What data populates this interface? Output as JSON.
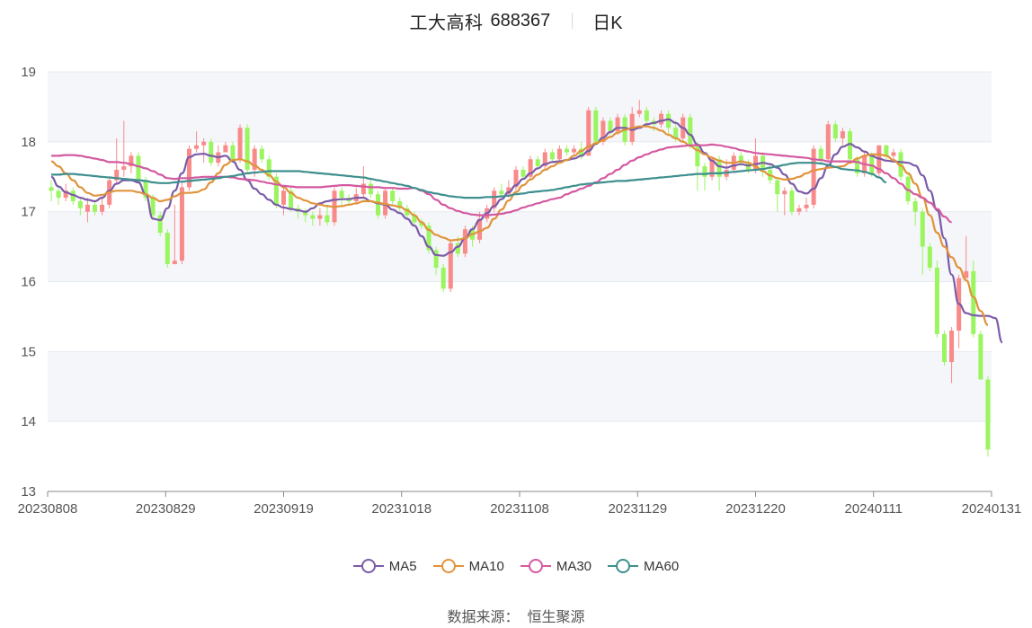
{
  "header": {
    "name": "工大高科",
    "code": "688367",
    "period": "日K"
  },
  "source": {
    "label": "数据来源：",
    "value": "恒生聚源"
  },
  "colors": {
    "up": "#f88a8a",
    "down": "#9af55f",
    "ma5": "#7b5ba8",
    "ma10": "#e0943c",
    "ma30": "#d35aa0",
    "ma60": "#3f8f8f",
    "grid": "#e6e9f0",
    "band": "#f5f6fa"
  },
  "chart_data": {
    "type": "candlestick",
    "ylim": [
      13,
      19
    ],
    "yticks": [
      "13",
      "14",
      "15",
      "16",
      "17",
      "18",
      "19"
    ],
    "x_tick_labels": [
      "20230808",
      "20230829",
      "20230919",
      "20231018",
      "20231108",
      "20231129",
      "20231220",
      "20240111",
      "20240131"
    ],
    "legend": [
      "MA5",
      "MA10",
      "MA30",
      "MA60"
    ],
    "candles": [
      [
        17.35,
        17.3,
        17.45,
        17.15
      ],
      [
        17.3,
        17.2,
        17.35,
        17.1
      ],
      [
        17.2,
        17.3,
        17.4,
        17.15
      ],
      [
        17.3,
        17.15,
        17.35,
        17.1
      ],
      [
        17.15,
        17.05,
        17.2,
        16.95
      ],
      [
        17.0,
        17.1,
        17.2,
        16.85
      ],
      [
        17.1,
        17.0,
        17.15,
        16.95
      ],
      [
        17.0,
        17.1,
        17.2,
        16.95
      ],
      [
        17.1,
        17.45,
        17.5,
        17.05
      ],
      [
        17.45,
        17.6,
        18.05,
        17.4
      ],
      [
        17.6,
        17.65,
        18.3,
        17.5
      ],
      [
        17.65,
        17.8,
        17.85,
        17.55
      ],
      [
        17.8,
        17.45,
        17.85,
        17.4
      ],
      [
        17.45,
        17.2,
        17.5,
        17.15
      ],
      [
        17.2,
        16.95,
        17.25,
        16.9
      ],
      [
        16.95,
        16.7,
        17.0,
        16.65
      ],
      [
        16.7,
        16.25,
        16.75,
        16.2
      ],
      [
        16.25,
        16.3,
        17.1,
        16.25
      ],
      [
        16.3,
        17.35,
        17.45,
        16.25
      ],
      [
        17.35,
        17.9,
        17.95,
        17.3
      ],
      [
        17.9,
        17.95,
        18.15,
        17.85
      ],
      [
        17.95,
        18.0,
        18.05,
        17.7
      ],
      [
        18.0,
        17.7,
        18.05,
        17.65
      ],
      [
        17.7,
        17.85,
        17.95,
        17.65
      ],
      [
        17.85,
        17.95,
        18.0,
        17.85
      ],
      [
        17.95,
        17.75,
        18.0,
        17.7
      ],
      [
        17.75,
        18.2,
        18.25,
        17.7
      ],
      [
        18.2,
        17.6,
        18.25,
        17.55
      ],
      [
        17.6,
        17.9,
        17.95,
        17.5
      ],
      [
        17.9,
        17.75,
        17.95,
        17.7
      ],
      [
        17.75,
        17.5,
        17.8,
        17.45
      ],
      [
        17.5,
        17.1,
        17.55,
        17.05
      ],
      [
        17.1,
        17.3,
        17.35,
        16.95
      ],
      [
        17.3,
        17.05,
        17.35,
        17.0
      ],
      [
        17.05,
        17.0,
        17.1,
        16.9
      ],
      [
        17.0,
        16.95,
        17.05,
        16.85
      ],
      [
        16.95,
        16.9,
        17.0,
        16.8
      ],
      [
        16.9,
        16.95,
        17.05,
        16.8
      ],
      [
        16.95,
        16.85,
        17.1,
        16.8
      ],
      [
        16.85,
        17.3,
        17.35,
        16.8
      ],
      [
        17.3,
        17.2,
        17.35,
        17.1
      ],
      [
        17.2,
        17.15,
        17.25,
        17.1
      ],
      [
        17.15,
        17.25,
        17.35,
        17.1
      ],
      [
        17.25,
        17.4,
        17.65,
        17.2
      ],
      [
        17.4,
        17.25,
        17.45,
        17.2
      ],
      [
        17.25,
        16.95,
        17.3,
        16.9
      ],
      [
        16.95,
        17.3,
        17.35,
        16.9
      ],
      [
        17.3,
        17.15,
        17.35,
        17.1
      ],
      [
        17.15,
        17.05,
        17.2,
        17.0
      ],
      [
        17.05,
        16.95,
        17.1,
        16.9
      ],
      [
        16.95,
        16.85,
        17.0,
        16.8
      ],
      [
        16.85,
        16.8,
        16.9,
        16.75
      ],
      [
        16.8,
        16.45,
        16.85,
        16.4
      ],
      [
        16.45,
        16.2,
        16.5,
        16.1
      ],
      [
        16.2,
        15.9,
        16.25,
        15.85
      ],
      [
        15.9,
        16.55,
        16.6,
        15.85
      ],
      [
        16.55,
        16.4,
        16.65,
        16.35
      ],
      [
        16.4,
        16.75,
        16.8,
        16.35
      ],
      [
        16.75,
        16.6,
        16.8,
        16.5
      ],
      [
        16.6,
        16.9,
        17.0,
        16.55
      ],
      [
        16.9,
        17.05,
        17.1,
        16.85
      ],
      [
        17.05,
        17.3,
        17.35,
        17.0
      ],
      [
        17.3,
        17.25,
        17.4,
        17.2
      ],
      [
        17.25,
        17.35,
        17.45,
        17.2
      ],
      [
        17.35,
        17.6,
        17.65,
        17.3
      ],
      [
        17.6,
        17.5,
        17.65,
        17.45
      ],
      [
        17.5,
        17.75,
        17.8,
        17.45
      ],
      [
        17.75,
        17.65,
        17.8,
        17.6
      ],
      [
        17.65,
        17.85,
        17.9,
        17.6
      ],
      [
        17.85,
        17.75,
        17.9,
        17.7
      ],
      [
        17.75,
        17.9,
        17.95,
        17.7
      ],
      [
        17.9,
        17.85,
        17.95,
        17.8
      ],
      [
        17.85,
        17.9,
        17.95,
        17.8
      ],
      [
        17.9,
        17.8,
        18.0,
        17.75
      ],
      [
        17.8,
        18.45,
        18.5,
        17.8
      ],
      [
        18.45,
        18.0,
        18.5,
        17.95
      ],
      [
        18.0,
        18.3,
        18.35,
        17.95
      ],
      [
        18.3,
        18.15,
        18.35,
        18.1
      ],
      [
        18.15,
        18.35,
        18.4,
        18.1
      ],
      [
        18.35,
        18.0,
        18.4,
        17.95
      ],
      [
        18.0,
        18.4,
        18.5,
        17.95
      ],
      [
        18.4,
        18.45,
        18.6,
        18.35
      ],
      [
        18.45,
        18.3,
        18.5,
        18.25
      ],
      [
        18.3,
        18.25,
        18.35,
        18.15
      ],
      [
        18.25,
        18.4,
        18.45,
        18.2
      ],
      [
        18.4,
        18.2,
        18.45,
        18.1
      ],
      [
        18.2,
        18.05,
        18.3,
        18.0
      ],
      [
        18.05,
        18.35,
        18.4,
        18.0
      ],
      [
        18.35,
        17.95,
        18.4,
        17.9
      ],
      [
        17.95,
        17.65,
        18.0,
        17.3
      ],
      [
        17.65,
        17.5,
        17.7,
        17.3
      ],
      [
        17.5,
        17.75,
        17.8,
        17.45
      ],
      [
        17.75,
        17.5,
        17.8,
        17.3
      ],
      [
        17.5,
        17.6,
        17.75,
        17.45
      ],
      [
        17.6,
        17.8,
        17.85,
        17.55
      ],
      [
        17.8,
        17.7,
        17.85,
        17.65
      ],
      [
        17.7,
        17.6,
        17.75,
        17.55
      ],
      [
        17.6,
        17.8,
        18.05,
        17.55
      ],
      [
        17.8,
        17.6,
        17.85,
        17.5
      ],
      [
        17.6,
        17.45,
        17.7,
        17.4
      ],
      [
        17.45,
        17.25,
        17.5,
        17.0
      ],
      [
        17.25,
        17.3,
        17.35,
        16.95
      ],
      [
        17.3,
        17.0,
        17.35,
        16.95
      ],
      [
        17.0,
        17.05,
        17.1,
        16.95
      ],
      [
        17.05,
        17.1,
        17.2,
        17.0
      ],
      [
        17.1,
        17.9,
        17.95,
        17.05
      ],
      [
        17.9,
        17.75,
        17.95,
        17.7
      ],
      [
        17.75,
        18.25,
        18.3,
        17.7
      ],
      [
        18.25,
        18.05,
        18.3,
        18.0
      ],
      [
        18.05,
        18.15,
        18.2,
        17.95
      ],
      [
        18.15,
        17.75,
        18.2,
        17.7
      ],
      [
        17.75,
        17.55,
        17.8,
        17.5
      ],
      [
        17.55,
        17.8,
        17.85,
        17.5
      ],
      [
        17.8,
        17.55,
        17.85,
        17.5
      ],
      [
        17.55,
        17.95,
        17.95,
        17.5
      ],
      [
        17.95,
        17.8,
        17.95,
        17.75
      ],
      [
        17.8,
        17.85,
        17.9,
        17.75
      ],
      [
        17.85,
        17.5,
        17.9,
        17.45
      ],
      [
        17.5,
        17.15,
        17.55,
        17.1
      ],
      [
        17.15,
        17.0,
        17.2,
        16.8
      ],
      [
        17.0,
        16.5,
        17.05,
        16.1
      ],
      [
        16.5,
        16.2,
        16.55,
        16.15
      ],
      [
        16.2,
        15.25,
        16.3,
        15.2
      ],
      [
        15.25,
        14.85,
        15.3,
        14.8
      ],
      [
        14.85,
        15.3,
        15.35,
        14.55
      ],
      [
        15.3,
        16.05,
        16.1,
        15.05
      ],
      [
        16.05,
        16.15,
        16.65,
        16.05
      ],
      [
        16.15,
        15.25,
        16.3,
        15.2
      ],
      [
        15.25,
        14.6,
        15.3,
        14.6
      ],
      [
        14.6,
        13.6,
        14.65,
        13.5
      ]
    ],
    "series": [
      {
        "name": "MA5",
        "values": [
          17.5,
          17.36,
          17.28,
          17.24,
          17.2,
          17.17,
          17.15,
          17.2,
          17.3,
          17.4,
          17.45,
          17.45,
          17.42,
          17.25,
          16.9,
          16.88,
          17.05,
          17.3,
          17.55,
          17.78,
          17.82,
          17.83,
          17.8,
          17.78,
          17.8,
          17.72,
          17.6,
          17.45,
          17.33,
          17.25,
          17.17,
          17.1,
          17.06,
          17.04,
          17.02,
          17.0,
          17.05,
          17.12,
          17.15,
          17.17,
          17.18,
          17.18,
          17.2,
          17.2,
          17.15,
          17.12,
          17.1,
          17.03,
          16.98,
          16.9,
          16.8,
          16.65,
          16.5,
          16.38,
          16.37,
          16.42,
          16.5,
          16.62,
          16.75,
          16.88,
          16.98,
          17.08,
          17.18,
          17.28,
          17.38,
          17.47,
          17.55,
          17.62,
          17.68,
          17.71,
          17.72,
          17.74,
          17.76,
          17.8,
          17.87,
          17.97,
          18.06,
          18.14,
          18.2,
          18.2,
          18.17,
          18.2,
          18.25,
          18.27,
          18.3,
          18.32,
          18.27,
          18.2,
          18.1,
          17.96,
          17.84,
          17.73,
          17.65,
          17.63,
          17.66,
          17.68,
          17.66,
          17.68,
          17.7,
          17.68,
          17.63,
          17.53,
          17.4,
          17.29,
          17.26,
          17.33,
          17.48,
          17.66,
          17.82,
          17.93,
          17.97,
          17.92,
          17.86,
          17.8,
          17.76,
          17.73,
          17.72,
          17.71,
          17.7,
          17.66,
          17.52,
          17.3,
          17.02,
          16.62,
          16.1,
          15.68,
          15.55,
          15.52,
          15.51,
          15.51,
          15.48,
          15.13
        ]
      },
      {
        "name": "MA10",
        "values": [
          17.72,
          17.65,
          17.55,
          17.45,
          17.35,
          17.27,
          17.23,
          17.24,
          17.28,
          17.3,
          17.3,
          17.3,
          17.28,
          17.25,
          17.2,
          17.15,
          17.17,
          17.22,
          17.27,
          17.27,
          17.28,
          17.32,
          17.42,
          17.55,
          17.67,
          17.74,
          17.75,
          17.72,
          17.66,
          17.6,
          17.52,
          17.43,
          17.35,
          17.27,
          17.2,
          17.16,
          17.12,
          17.1,
          17.08,
          17.07,
          17.08,
          17.1,
          17.12,
          17.15,
          17.15,
          17.13,
          17.11,
          17.09,
          17.07,
          17.02,
          16.95,
          16.85,
          16.74,
          16.67,
          16.63,
          16.59,
          16.6,
          16.62,
          16.68,
          16.72,
          16.77,
          16.9,
          17.03,
          17.16,
          17.28,
          17.38,
          17.46,
          17.53,
          17.6,
          17.65,
          17.7,
          17.74,
          17.8,
          17.87,
          17.93,
          17.98,
          18.02,
          18.07,
          18.13,
          18.17,
          18.2,
          18.22,
          18.22,
          18.2,
          18.16,
          18.1,
          18.05,
          18.0,
          17.94,
          17.88,
          17.82,
          17.77,
          17.73,
          17.7,
          17.7,
          17.72,
          17.7,
          17.65,
          17.58,
          17.52,
          17.48,
          17.46,
          17.47,
          17.5,
          17.55,
          17.59,
          17.61,
          17.63,
          17.64,
          17.65,
          17.7,
          17.76,
          17.8,
          17.82,
          17.82,
          17.8,
          17.74,
          17.66,
          17.55,
          17.4,
          17.2,
          16.95,
          16.7,
          16.5,
          16.35,
          16.2,
          16.02,
          15.78,
          15.58,
          15.38
        ]
      },
      {
        "name": "MA30",
        "values": [
          17.8,
          17.8,
          17.81,
          17.81,
          17.8,
          17.78,
          17.76,
          17.74,
          17.71,
          17.71,
          17.7,
          17.68,
          17.65,
          17.62,
          17.58,
          17.53,
          17.48,
          17.47,
          17.48,
          17.48,
          17.49,
          17.5,
          17.5,
          17.5,
          17.5,
          17.49,
          17.47,
          17.46,
          17.45,
          17.43,
          17.41,
          17.39,
          17.37,
          17.36,
          17.35,
          17.35,
          17.35,
          17.35,
          17.36,
          17.37,
          17.38,
          17.38,
          17.37,
          17.36,
          17.35,
          17.35,
          17.34,
          17.34,
          17.33,
          17.33,
          17.34,
          17.3,
          17.25,
          17.17,
          17.1,
          17.05,
          17.01,
          16.98,
          16.96,
          16.95,
          16.95,
          16.96,
          16.97,
          16.99,
          17.02,
          17.06,
          17.09,
          17.12,
          17.15,
          17.18,
          17.2,
          17.25,
          17.29,
          17.33,
          17.37,
          17.42,
          17.48,
          17.54,
          17.6,
          17.67,
          17.73,
          17.78,
          17.82,
          17.86,
          17.89,
          17.92,
          17.93,
          17.94,
          17.95,
          17.95,
          17.95,
          17.96,
          17.95,
          17.93,
          17.91,
          17.88,
          17.86,
          17.84,
          17.83,
          17.82,
          17.81,
          17.8,
          17.79,
          17.78,
          17.77,
          17.75,
          17.74,
          17.72,
          17.72,
          17.72,
          17.72,
          17.71,
          17.68,
          17.66,
          17.61,
          17.55,
          17.48,
          17.4,
          17.31,
          17.25,
          17.2,
          17.13,
          17.04,
          16.93,
          16.85
        ]
      },
      {
        "name": "MA60",
        "values": [
          17.53,
          17.53,
          17.54,
          17.54,
          17.53,
          17.52,
          17.51,
          17.5,
          17.49,
          17.48,
          17.47,
          17.46,
          17.45,
          17.44,
          17.42,
          17.41,
          17.41,
          17.42,
          17.43,
          17.44,
          17.45,
          17.46,
          17.47,
          17.48,
          17.5,
          17.51,
          17.53,
          17.55,
          17.56,
          17.57,
          17.58,
          17.58,
          17.58,
          17.58,
          17.58,
          17.57,
          17.56,
          17.55,
          17.54,
          17.53,
          17.52,
          17.51,
          17.5,
          17.49,
          17.47,
          17.45,
          17.43,
          17.41,
          17.39,
          17.37,
          17.34,
          17.31,
          17.28,
          17.26,
          17.24,
          17.22,
          17.21,
          17.2,
          17.2,
          17.2,
          17.21,
          17.21,
          17.22,
          17.23,
          17.25,
          17.26,
          17.28,
          17.29,
          17.3,
          17.31,
          17.33,
          17.35,
          17.37,
          17.39,
          17.4,
          17.41,
          17.42,
          17.43,
          17.44,
          17.44,
          17.45,
          17.46,
          17.47,
          17.48,
          17.49,
          17.5,
          17.51,
          17.52,
          17.53,
          17.54,
          17.54,
          17.55,
          17.55,
          17.56,
          17.57,
          17.58,
          17.59,
          17.6,
          17.61,
          17.63,
          17.65,
          17.67,
          17.69,
          17.7,
          17.7,
          17.7,
          17.69,
          17.67,
          17.64,
          17.61,
          17.6,
          17.59,
          17.57,
          17.54,
          17.49,
          17.42
        ]
      }
    ]
  }
}
